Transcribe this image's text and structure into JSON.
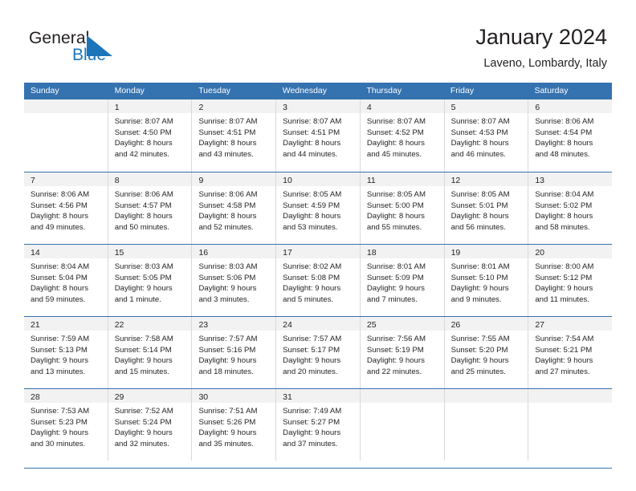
{
  "brand": {
    "name_part1": "General",
    "name_part2": "Blue",
    "accent_color": "#1b75bb"
  },
  "header": {
    "title": "January 2024",
    "subtitle": "Laveno, Lombardy, Italy"
  },
  "theme": {
    "header_row_bg": "#3572b0",
    "daynum_band_bg": "#f2f2f2",
    "cell_border": "#d9d9d9"
  },
  "weekdays": [
    "Sunday",
    "Monday",
    "Tuesday",
    "Wednesday",
    "Thursday",
    "Friday",
    "Saturday"
  ],
  "weeks": [
    [
      {
        "day": "",
        "lines": []
      },
      {
        "day": "1",
        "lines": [
          "Sunrise: 8:07 AM",
          "Sunset: 4:50 PM",
          "Daylight: 8 hours",
          "and 42 minutes."
        ]
      },
      {
        "day": "2",
        "lines": [
          "Sunrise: 8:07 AM",
          "Sunset: 4:51 PM",
          "Daylight: 8 hours",
          "and 43 minutes."
        ]
      },
      {
        "day": "3",
        "lines": [
          "Sunrise: 8:07 AM",
          "Sunset: 4:51 PM",
          "Daylight: 8 hours",
          "and 44 minutes."
        ]
      },
      {
        "day": "4",
        "lines": [
          "Sunrise: 8:07 AM",
          "Sunset: 4:52 PM",
          "Daylight: 8 hours",
          "and 45 minutes."
        ]
      },
      {
        "day": "5",
        "lines": [
          "Sunrise: 8:07 AM",
          "Sunset: 4:53 PM",
          "Daylight: 8 hours",
          "and 46 minutes."
        ]
      },
      {
        "day": "6",
        "lines": [
          "Sunrise: 8:06 AM",
          "Sunset: 4:54 PM",
          "Daylight: 8 hours",
          "and 48 minutes."
        ]
      }
    ],
    [
      {
        "day": "7",
        "lines": [
          "Sunrise: 8:06 AM",
          "Sunset: 4:56 PM",
          "Daylight: 8 hours",
          "and 49 minutes."
        ]
      },
      {
        "day": "8",
        "lines": [
          "Sunrise: 8:06 AM",
          "Sunset: 4:57 PM",
          "Daylight: 8 hours",
          "and 50 minutes."
        ]
      },
      {
        "day": "9",
        "lines": [
          "Sunrise: 8:06 AM",
          "Sunset: 4:58 PM",
          "Daylight: 8 hours",
          "and 52 minutes."
        ]
      },
      {
        "day": "10",
        "lines": [
          "Sunrise: 8:05 AM",
          "Sunset: 4:59 PM",
          "Daylight: 8 hours",
          "and 53 minutes."
        ]
      },
      {
        "day": "11",
        "lines": [
          "Sunrise: 8:05 AM",
          "Sunset: 5:00 PM",
          "Daylight: 8 hours",
          "and 55 minutes."
        ]
      },
      {
        "day": "12",
        "lines": [
          "Sunrise: 8:05 AM",
          "Sunset: 5:01 PM",
          "Daylight: 8 hours",
          "and 56 minutes."
        ]
      },
      {
        "day": "13",
        "lines": [
          "Sunrise: 8:04 AM",
          "Sunset: 5:02 PM",
          "Daylight: 8 hours",
          "and 58 minutes."
        ]
      }
    ],
    [
      {
        "day": "14",
        "lines": [
          "Sunrise: 8:04 AM",
          "Sunset: 5:04 PM",
          "Daylight: 8 hours",
          "and 59 minutes."
        ]
      },
      {
        "day": "15",
        "lines": [
          "Sunrise: 8:03 AM",
          "Sunset: 5:05 PM",
          "Daylight: 9 hours",
          "and 1 minute."
        ]
      },
      {
        "day": "16",
        "lines": [
          "Sunrise: 8:03 AM",
          "Sunset: 5:06 PM",
          "Daylight: 9 hours",
          "and 3 minutes."
        ]
      },
      {
        "day": "17",
        "lines": [
          "Sunrise: 8:02 AM",
          "Sunset: 5:08 PM",
          "Daylight: 9 hours",
          "and 5 minutes."
        ]
      },
      {
        "day": "18",
        "lines": [
          "Sunrise: 8:01 AM",
          "Sunset: 5:09 PM",
          "Daylight: 9 hours",
          "and 7 minutes."
        ]
      },
      {
        "day": "19",
        "lines": [
          "Sunrise: 8:01 AM",
          "Sunset: 5:10 PM",
          "Daylight: 9 hours",
          "and 9 minutes."
        ]
      },
      {
        "day": "20",
        "lines": [
          "Sunrise: 8:00 AM",
          "Sunset: 5:12 PM",
          "Daylight: 9 hours",
          "and 11 minutes."
        ]
      }
    ],
    [
      {
        "day": "21",
        "lines": [
          "Sunrise: 7:59 AM",
          "Sunset: 5:13 PM",
          "Daylight: 9 hours",
          "and 13 minutes."
        ]
      },
      {
        "day": "22",
        "lines": [
          "Sunrise: 7:58 AM",
          "Sunset: 5:14 PM",
          "Daylight: 9 hours",
          "and 15 minutes."
        ]
      },
      {
        "day": "23",
        "lines": [
          "Sunrise: 7:57 AM",
          "Sunset: 5:16 PM",
          "Daylight: 9 hours",
          "and 18 minutes."
        ]
      },
      {
        "day": "24",
        "lines": [
          "Sunrise: 7:57 AM",
          "Sunset: 5:17 PM",
          "Daylight: 9 hours",
          "and 20 minutes."
        ]
      },
      {
        "day": "25",
        "lines": [
          "Sunrise: 7:56 AM",
          "Sunset: 5:19 PM",
          "Daylight: 9 hours",
          "and 22 minutes."
        ]
      },
      {
        "day": "26",
        "lines": [
          "Sunrise: 7:55 AM",
          "Sunset: 5:20 PM",
          "Daylight: 9 hours",
          "and 25 minutes."
        ]
      },
      {
        "day": "27",
        "lines": [
          "Sunrise: 7:54 AM",
          "Sunset: 5:21 PM",
          "Daylight: 9 hours",
          "and 27 minutes."
        ]
      }
    ],
    [
      {
        "day": "28",
        "lines": [
          "Sunrise: 7:53 AM",
          "Sunset: 5:23 PM",
          "Daylight: 9 hours",
          "and 30 minutes."
        ]
      },
      {
        "day": "29",
        "lines": [
          "Sunrise: 7:52 AM",
          "Sunset: 5:24 PM",
          "Daylight: 9 hours",
          "and 32 minutes."
        ]
      },
      {
        "day": "30",
        "lines": [
          "Sunrise: 7:51 AM",
          "Sunset: 5:26 PM",
          "Daylight: 9 hours",
          "and 35 minutes."
        ]
      },
      {
        "day": "31",
        "lines": [
          "Sunrise: 7:49 AM",
          "Sunset: 5:27 PM",
          "Daylight: 9 hours",
          "and 37 minutes."
        ]
      },
      {
        "day": "",
        "lines": []
      },
      {
        "day": "",
        "lines": []
      },
      {
        "day": "",
        "lines": []
      }
    ]
  ]
}
